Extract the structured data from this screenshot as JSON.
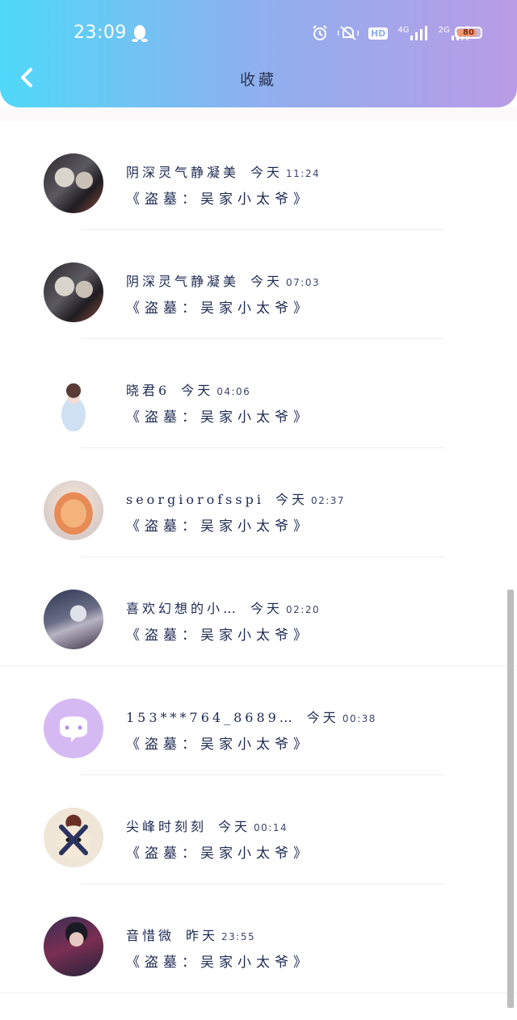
{
  "status_bar": {
    "time": "23:09",
    "network_4g": "4G",
    "network_2g": "2G",
    "hd": "HD",
    "battery": "80"
  },
  "header": {
    "title": "收藏"
  },
  "items": [
    {
      "name": "阴深灵气静凝美",
      "when": "今天",
      "time": "11:24",
      "book": "《盗墓：吴家小太爷》"
    },
    {
      "name": "阴深灵气静凝美",
      "when": "今天",
      "time": "07:03",
      "book": "《盗墓：吴家小太爷》"
    },
    {
      "name": "晓君6",
      "when": "今天",
      "time": "04:06",
      "book": "《盗墓：吴家小太爷》"
    },
    {
      "name": "seorgiorofsspi",
      "when": "今天",
      "time": "02:37",
      "book": "《盗墓：吴家小太爷》"
    },
    {
      "name": "喜欢幻想的小…",
      "when": "今天",
      "time": "02:20",
      "book": "《盗墓：吴家小太爷》"
    },
    {
      "name": "153***764_8689…",
      "when": "今天",
      "time": "00:38",
      "book": "《盗墓：吴家小太爷》"
    },
    {
      "name": "尖峰时刻刻",
      "when": "今天",
      "time": "00:14",
      "book": "《盗墓：吴家小太爷》"
    },
    {
      "name": "音惜微",
      "when": "昨天",
      "time": "23:55",
      "book": "《盗墓：吴家小太爷》"
    }
  ],
  "colors": {
    "header_start": "#4fd8f9",
    "header_end": "#b99be6",
    "text": "#1d2a52",
    "battery_fill": "#f29a72"
  }
}
